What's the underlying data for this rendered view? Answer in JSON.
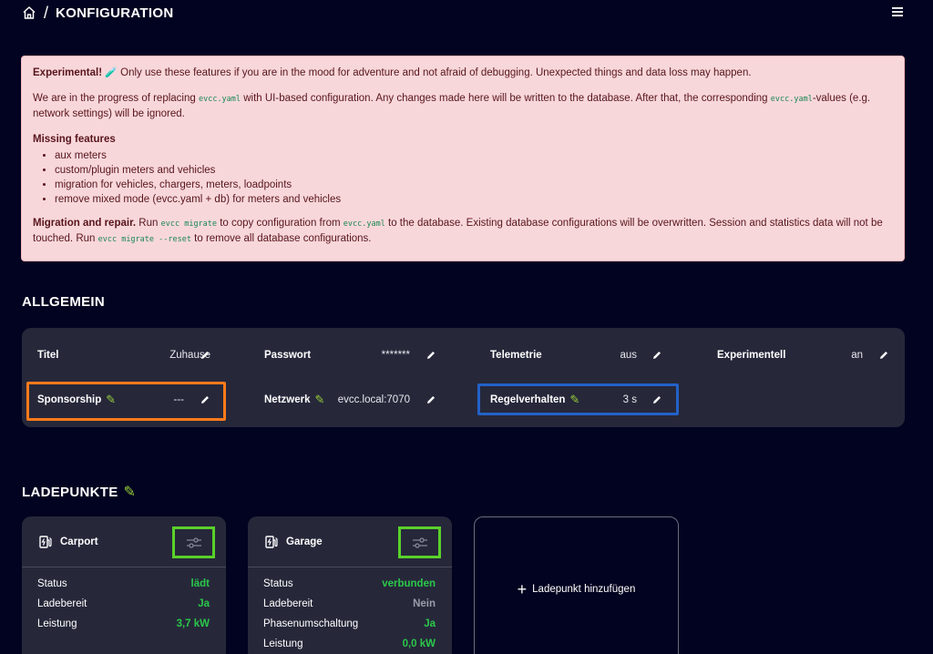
{
  "header": {
    "separator": "/",
    "title": "KONFIGURATION"
  },
  "alert": {
    "p1_bold": "Experimental!",
    "p1_text": " Only use these features if you are in the mood for adventure and not afraid of debugging. Unexpected things and data loss may happen.",
    "p2_a": "We are in the progress of replacing ",
    "p2_code1": "evcc.yaml",
    "p2_b": " with UI-based configuration. Any changes made here will be written to the database. After that, the corresponding ",
    "p2_code2": "evcc.yaml",
    "p2_c": "-values (e.g. network settings) will be ignored.",
    "missing_title": "Missing features",
    "missing_items": [
      "aux meters",
      "custom/plugin meters and vehicles",
      "migration for vehicles, chargers, meters, loadpoints",
      "remove mixed mode (evcc.yaml + db) for meters and vehicles"
    ],
    "p4_bold": "Migration and repair.",
    "p4_a": " Run ",
    "p4_code1": "evcc migrate",
    "p4_b": " to copy configuration from ",
    "p4_code2": "evcc.yaml",
    "p4_c": " to the database. Existing database configurations will be overwritten. Session and statistics data will not be touched. Run ",
    "p4_code3": "evcc migrate --reset",
    "p4_d": " to remove all database configurations."
  },
  "general": {
    "title": "ALLGEMEIN",
    "items": [
      {
        "label": "Titel",
        "value": "Zuhause"
      },
      {
        "label": "Passwort",
        "value": "*******"
      },
      {
        "label": "Telemetrie",
        "value": "aus"
      },
      {
        "label": "Experimentell",
        "value": "an"
      },
      {
        "label": "Sponsorship",
        "value": "---"
      },
      {
        "label": "Netzwerk",
        "value": "evcc.local:7070"
      },
      {
        "label": "Regelverhalten",
        "value": "3 s"
      }
    ]
  },
  "loadpoints": {
    "title": "LADEPUNKTE",
    "cards": [
      {
        "name": "Carport",
        "rows": [
          {
            "k": "Status",
            "v": "lädt"
          },
          {
            "k": "Ladebereit",
            "v": "Ja"
          },
          {
            "k": "Leistung",
            "v": "3,7 kW"
          }
        ]
      },
      {
        "name": "Garage",
        "rows": [
          {
            "k": "Status",
            "v": "verbunden"
          },
          {
            "k": "Ladebereit",
            "v": "Nein"
          },
          {
            "k": "Phasenumschaltung",
            "v": "Ja"
          },
          {
            "k": "Leistung",
            "v": "0,0 kW"
          }
        ]
      }
    ],
    "add_label": "Ladepunkt hinzufügen"
  },
  "colors": {
    "background": "#020320",
    "panel": "#26283a",
    "alert_bg": "#f8d7da",
    "highlight_orange": "#ff7a1a",
    "highlight_blue": "#2361c7",
    "highlight_green": "#5ad12a",
    "status_green": "#2bc84a"
  }
}
